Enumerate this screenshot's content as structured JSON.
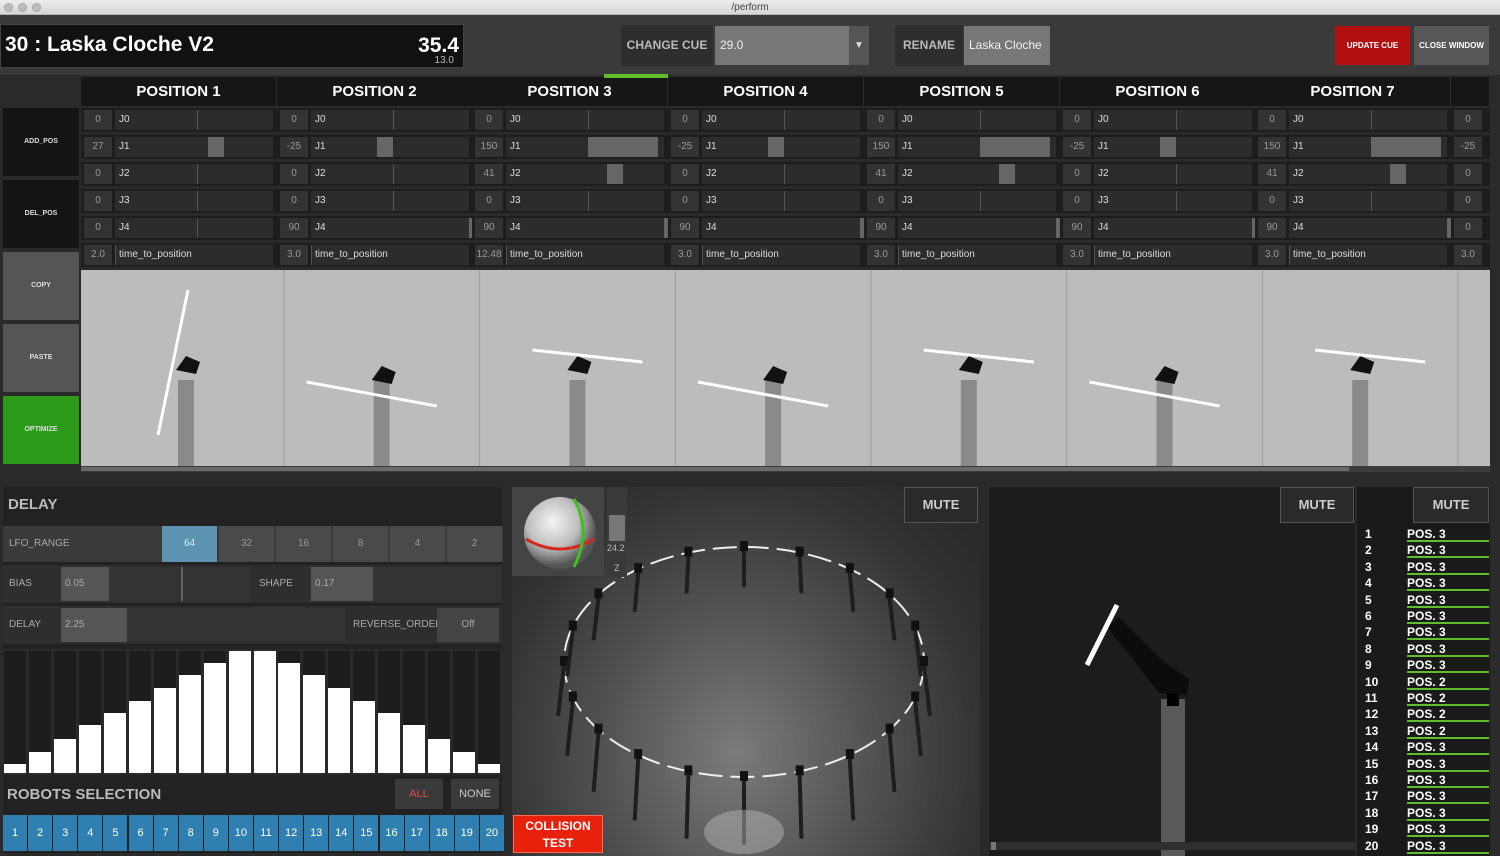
{
  "window": {
    "title": "/perform"
  },
  "cue": {
    "title": "30 : Laska Cloche V2",
    "number": "35.4",
    "sub": "13.0"
  },
  "change_cue": {
    "label": "CHANGE CUE",
    "value": "29.0"
  },
  "rename": {
    "label": "RENAME",
    "value": "Laska Cloche"
  },
  "buttons": {
    "update_cue": "UPDATE CUE",
    "close_window": "CLOSE WINDOW"
  },
  "side_buttons": [
    "ADD_POS",
    "DEL_POS",
    "COPY",
    "PASTE",
    "OPTIMIZE"
  ],
  "joints": [
    "J0",
    "J1",
    "J2",
    "J3",
    "J4"
  ],
  "time_label": "time_to_position",
  "positions": [
    {
      "name": "POSITION 1",
      "vals": [
        "0",
        "27",
        "0",
        "0",
        "0"
      ],
      "time": "2.0"
    },
    {
      "name": "POSITION 2",
      "vals": [
        "0",
        "-25",
        "0",
        "0",
        "90"
      ],
      "time": "3.0"
    },
    {
      "name": "POSITION 3",
      "vals": [
        "0",
        "150",
        "41",
        "0",
        "90"
      ],
      "time": "12.48"
    },
    {
      "name": "POSITION 4",
      "vals": [
        "0",
        "-25",
        "0",
        "0",
        "90"
      ],
      "time": "3.0"
    },
    {
      "name": "POSITION 5",
      "vals": [
        "0",
        "150",
        "41",
        "0",
        "90"
      ],
      "time": "3.0"
    },
    {
      "name": "POSITION 6",
      "vals": [
        "0",
        "-25",
        "0",
        "0",
        "90"
      ],
      "time": "3.0"
    },
    {
      "name": "POSITION 7",
      "vals": [
        "0",
        "150",
        "41",
        "0",
        "90"
      ],
      "time": "3.0"
    }
  ],
  "extra_col": {
    "vals": [
      "0",
      "-25",
      "0",
      "0",
      "0"
    ],
    "time": "3.0"
  },
  "delay": {
    "title": "DELAY",
    "lfo_label": "LFO_RANGE",
    "lfo_options": [
      "64",
      "32",
      "16",
      "8",
      "4",
      "2"
    ],
    "lfo_selected": 0,
    "bias_label": "BIAS",
    "bias_value": "0.05",
    "shape_label": "SHAPE",
    "shape_value": "0.17",
    "delay_label": "DELAY",
    "delay_value": "2.25",
    "reverse_label": "REVERSE_ORDER",
    "reverse_value": "Off",
    "bars": [
      0.07,
      0.17,
      0.28,
      0.39,
      0.49,
      0.59,
      0.7,
      0.8,
      0.9,
      1.0,
      1.0,
      0.9,
      0.8,
      0.7,
      0.59,
      0.49,
      0.39,
      0.28,
      0.17,
      0.07
    ]
  },
  "robots_selection": {
    "title": "ROBOTS SELECTION",
    "all": "ALL",
    "none": "NONE",
    "ids": [
      "1",
      "2",
      "3",
      "4",
      "5",
      "6",
      "7",
      "8",
      "9",
      "10",
      "11",
      "12",
      "13",
      "14",
      "15",
      "16",
      "17",
      "18",
      "19",
      "20"
    ]
  },
  "viewport": {
    "mute": "MUTE",
    "axis_value": "24.2",
    "axis_label": "Z",
    "collision": "COLLISION TEST"
  },
  "side_view": {
    "mute": "MUTE"
  },
  "list": {
    "mute": "MUTE",
    "items": [
      {
        "n": "1",
        "p": "POS. 3"
      },
      {
        "n": "2",
        "p": "POS. 3"
      },
      {
        "n": "3",
        "p": "POS. 3"
      },
      {
        "n": "4",
        "p": "POS. 3"
      },
      {
        "n": "5",
        "p": "POS. 3"
      },
      {
        "n": "6",
        "p": "POS. 3"
      },
      {
        "n": "7",
        "p": "POS. 3"
      },
      {
        "n": "8",
        "p": "POS. 3"
      },
      {
        "n": "9",
        "p": "POS. 3"
      },
      {
        "n": "10",
        "p": "POS. 2"
      },
      {
        "n": "11",
        "p": "POS. 2"
      },
      {
        "n": "12",
        "p": "POS. 2"
      },
      {
        "n": "13",
        "p": "POS. 2"
      },
      {
        "n": "14",
        "p": "POS. 3"
      },
      {
        "n": "15",
        "p": "POS. 3"
      },
      {
        "n": "16",
        "p": "POS. 3"
      },
      {
        "n": "17",
        "p": "POS. 3"
      },
      {
        "n": "18",
        "p": "POS. 3"
      },
      {
        "n": "19",
        "p": "POS. 3"
      },
      {
        "n": "20",
        "p": "POS. 3"
      }
    ]
  },
  "colors": {
    "accent_green": "#5fbf2a",
    "update_red": "#b3110f",
    "robot_blue": "#2f7fb0",
    "collision_red": "#e8210d"
  }
}
